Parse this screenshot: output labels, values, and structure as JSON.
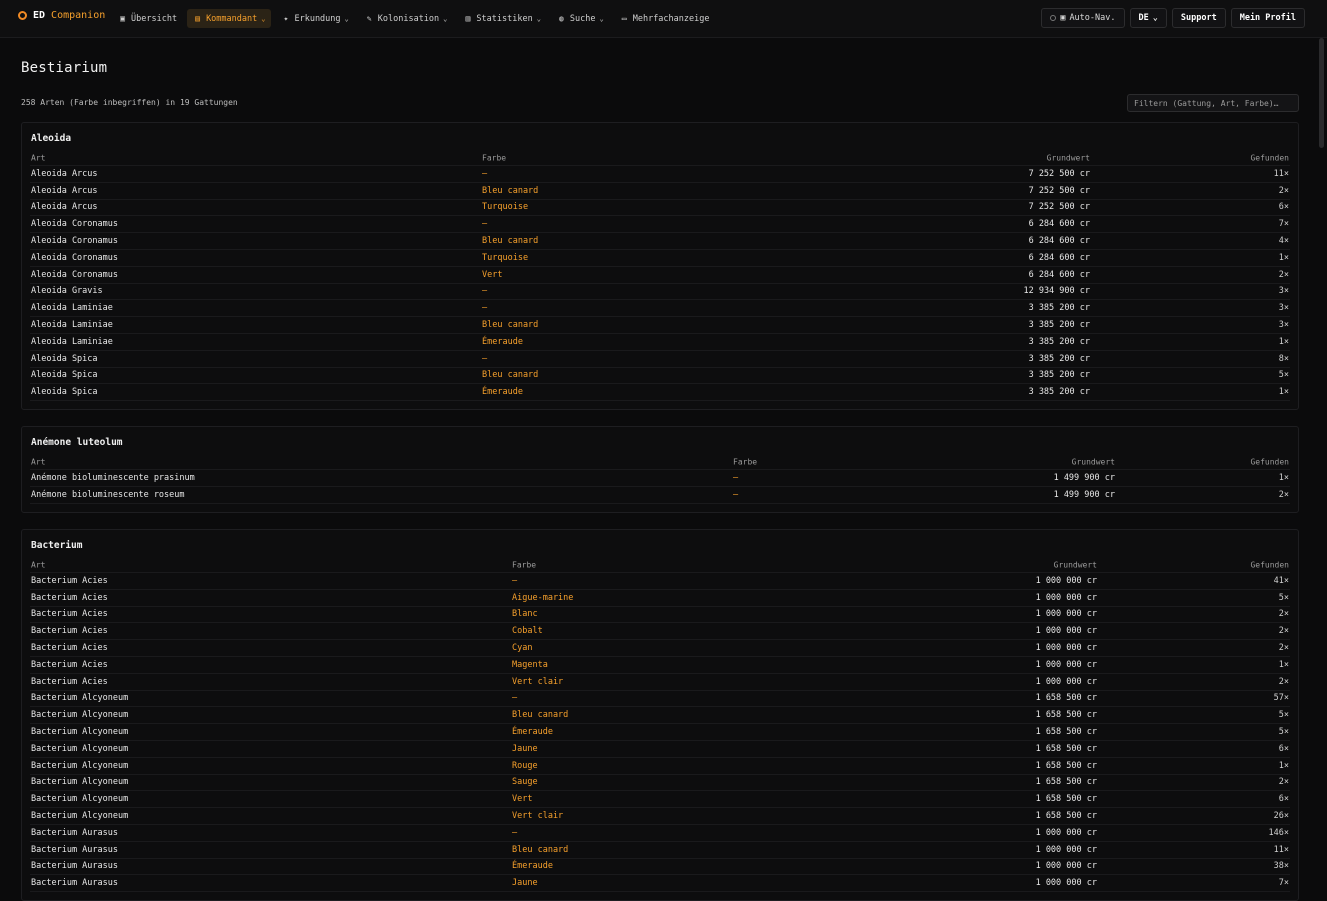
{
  "app": {
    "brand_main": "ED",
    "brand_accent": "Companion"
  },
  "nav": [
    {
      "label": "Übersicht",
      "icon": "home-icon",
      "glyph": "▣",
      "active": false,
      "chevron": false
    },
    {
      "label": "Kommandant",
      "icon": "commander-icon",
      "glyph": "▤",
      "active": true,
      "chevron": true
    },
    {
      "label": "Erkundung",
      "icon": "telescope-icon",
      "glyph": "✦",
      "active": false,
      "chevron": true
    },
    {
      "label": "Kolonisation",
      "icon": "colony-icon",
      "glyph": "✎",
      "active": false,
      "chevron": true
    },
    {
      "label": "Statistiken",
      "icon": "chart-icon",
      "glyph": "▥",
      "active": false,
      "chevron": true
    },
    {
      "label": "Suche",
      "icon": "search-icon",
      "glyph": "◍",
      "active": false,
      "chevron": true
    },
    {
      "label": "Mehrfachanzeige",
      "icon": "monitor-icon",
      "glyph": "▭",
      "active": false,
      "chevron": false
    }
  ],
  "tools": {
    "autonav": "Auto-Nav.",
    "lang": "DE",
    "support": "Support",
    "profile": "Mein Profil"
  },
  "page": {
    "title": "Bestiarium",
    "summary": "258 Arten (Farbe inbegriffen) in 19 Gattungen",
    "filter_placeholder": "Filtern (Gattung, Art, Farbe)…"
  },
  "columns": {
    "art": "Art",
    "farbe": "Farbe",
    "wert": "Grundwert",
    "found": "Gefunden"
  },
  "colors": {
    "accent": "#f6a02c",
    "background": "#0b0b0c"
  },
  "genera": [
    {
      "name": "Aleoida",
      "rows": [
        [
          "Aleoida Arcus",
          "—",
          "7 252 500 cr",
          "11×"
        ],
        [
          "Aleoida Arcus",
          "Bleu canard",
          "7 252 500 cr",
          "2×"
        ],
        [
          "Aleoida Arcus",
          "Turquoise",
          "7 252 500 cr",
          "6×"
        ],
        [
          "Aleoida Coronamus",
          "—",
          "6 284 600 cr",
          "7×"
        ],
        [
          "Aleoida Coronamus",
          "Bleu canard",
          "6 284 600 cr",
          "4×"
        ],
        [
          "Aleoida Coronamus",
          "Turquoise",
          "6 284 600 cr",
          "1×"
        ],
        [
          "Aleoida Coronamus",
          "Vert",
          "6 284 600 cr",
          "2×"
        ],
        [
          "Aleoida Gravis",
          "—",
          "12 934 900 cr",
          "3×"
        ],
        [
          "Aleoida Laminiae",
          "—",
          "3 385 200 cr",
          "3×"
        ],
        [
          "Aleoida Laminiae",
          "Bleu canard",
          "3 385 200 cr",
          "3×"
        ],
        [
          "Aleoida Laminiae",
          "Émeraude",
          "3 385 200 cr",
          "1×"
        ],
        [
          "Aleoida Spica",
          "—",
          "3 385 200 cr",
          "8×"
        ],
        [
          "Aleoida Spica",
          "Bleu canard",
          "3 385 200 cr",
          "5×"
        ],
        [
          "Aleoida Spica",
          "Émeraude",
          "3 385 200 cr",
          "1×"
        ]
      ]
    },
    {
      "name": "Anémone luteolum",
      "rows": [
        [
          "Anémone bioluminescente prasinum",
          "—",
          "1 499 900 cr",
          "1×"
        ],
        [
          "Anémone bioluminescente roseum",
          "—",
          "1 499 900 cr",
          "2×"
        ]
      ]
    },
    {
      "name": "Bacterium",
      "rows": [
        [
          "Bacterium Acies",
          "—",
          "1 000 000 cr",
          "41×"
        ],
        [
          "Bacterium Acies",
          "Aigue-marine",
          "1 000 000 cr",
          "5×"
        ],
        [
          "Bacterium Acies",
          "Blanc",
          "1 000 000 cr",
          "2×"
        ],
        [
          "Bacterium Acies",
          "Cobalt",
          "1 000 000 cr",
          "2×"
        ],
        [
          "Bacterium Acies",
          "Cyan",
          "1 000 000 cr",
          "2×"
        ],
        [
          "Bacterium Acies",
          "Magenta",
          "1 000 000 cr",
          "1×"
        ],
        [
          "Bacterium Acies",
          "Vert clair",
          "1 000 000 cr",
          "2×"
        ],
        [
          "Bacterium Alcyoneum",
          "—",
          "1 658 500 cr",
          "57×"
        ],
        [
          "Bacterium Alcyoneum",
          "Bleu canard",
          "1 658 500 cr",
          "5×"
        ],
        [
          "Bacterium Alcyoneum",
          "Émeraude",
          "1 658 500 cr",
          "5×"
        ],
        [
          "Bacterium Alcyoneum",
          "Jaune",
          "1 658 500 cr",
          "6×"
        ],
        [
          "Bacterium Alcyoneum",
          "Rouge",
          "1 658 500 cr",
          "1×"
        ],
        [
          "Bacterium Alcyoneum",
          "Sauge",
          "1 658 500 cr",
          "2×"
        ],
        [
          "Bacterium Alcyoneum",
          "Vert",
          "1 658 500 cr",
          "6×"
        ],
        [
          "Bacterium Alcyoneum",
          "Vert clair",
          "1 658 500 cr",
          "26×"
        ],
        [
          "Bacterium Aurasus",
          "—",
          "1 000 000 cr",
          "146×"
        ],
        [
          "Bacterium Aurasus",
          "Bleu canard",
          "1 000 000 cr",
          "11×"
        ],
        [
          "Bacterium Aurasus",
          "Émeraude",
          "1 000 000 cr",
          "38×"
        ],
        [
          "Bacterium Aurasus",
          "Jaune",
          "1 000 000 cr",
          "7×"
        ]
      ]
    }
  ]
}
